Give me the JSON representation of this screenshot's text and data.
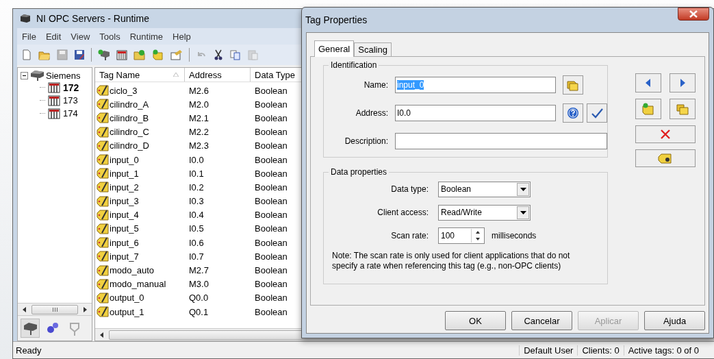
{
  "main_window": {
    "title": "NI OPC Servers - Runtime",
    "menu": [
      "File",
      "Edit",
      "View",
      "Tools",
      "Runtime",
      "Help"
    ],
    "tree": {
      "label": "Siemens",
      "expanded": true,
      "children": [
        {
          "label": "172",
          "selected": true
        },
        {
          "label": "173",
          "selected": false
        },
        {
          "label": "174",
          "selected": false
        }
      ]
    },
    "table": {
      "columns": [
        "Tag Name",
        "Address",
        "Data Type"
      ],
      "rows": [
        {
          "name": "ciclo_3",
          "address": "M2.6",
          "type": "Boolean"
        },
        {
          "name": "cilindro_A",
          "address": "M2.0",
          "type": "Boolean"
        },
        {
          "name": "cilindro_B",
          "address": "M2.1",
          "type": "Boolean"
        },
        {
          "name": "cilindro_C",
          "address": "M2.2",
          "type": "Boolean"
        },
        {
          "name": "cilindro_D",
          "address": "M2.3",
          "type": "Boolean"
        },
        {
          "name": "input_0",
          "address": "I0.0",
          "type": "Boolean"
        },
        {
          "name": "input_1",
          "address": "I0.1",
          "type": "Boolean"
        },
        {
          "name": "input_2",
          "address": "I0.2",
          "type": "Boolean"
        },
        {
          "name": "input_3",
          "address": "I0.3",
          "type": "Boolean"
        },
        {
          "name": "input_4",
          "address": "I0.4",
          "type": "Boolean"
        },
        {
          "name": "input_5",
          "address": "I0.5",
          "type": "Boolean"
        },
        {
          "name": "input_6",
          "address": "I0.6",
          "type": "Boolean"
        },
        {
          "name": "input_7",
          "address": "I0.7",
          "type": "Boolean"
        },
        {
          "name": "modo_auto",
          "address": "M2.7",
          "type": "Boolean"
        },
        {
          "name": "modo_manual",
          "address": "M3.0",
          "type": "Boolean"
        },
        {
          "name": "output_0",
          "address": "Q0.0",
          "type": "Boolean"
        },
        {
          "name": "output_1",
          "address": "Q0.1",
          "type": "Boolean"
        }
      ]
    },
    "status_bar": {
      "message": "Ready",
      "user": "Default User",
      "clients": "Clients:  0",
      "active_tags": "Active tags:  0 of 0"
    }
  },
  "dialog": {
    "title": "Tag Properties",
    "tabs": [
      {
        "label": "General",
        "selected": true
      },
      {
        "label": "Scaling",
        "selected": false
      }
    ],
    "identification": {
      "legend": "Identification",
      "name_label": "Name:",
      "name_value": "input_0",
      "name_selected": true,
      "address_label": "Address:",
      "address_value": "I0.0",
      "description_label": "Description:"
    },
    "data_properties": {
      "legend": "Data properties",
      "data_type_label": "Data type:",
      "data_type": "Boolean",
      "client_access_label": "Client access:",
      "client_access": "Read/Write",
      "scan_rate_label": "Scan rate:",
      "scan_rate": "100",
      "scan_rate_unit": "milliseconds",
      "note": "Note: The scan rate is only used for client applications that do not specify a rate when referencing this tag (e.g., non-OPC clients)"
    },
    "buttons": [
      {
        "label": "OK",
        "disabled": false
      },
      {
        "label": "Cancelar",
        "disabled": false
      },
      {
        "label": "Aplicar",
        "disabled": true
      },
      {
        "label": "Ajuda",
        "disabled": false
      }
    ]
  }
}
